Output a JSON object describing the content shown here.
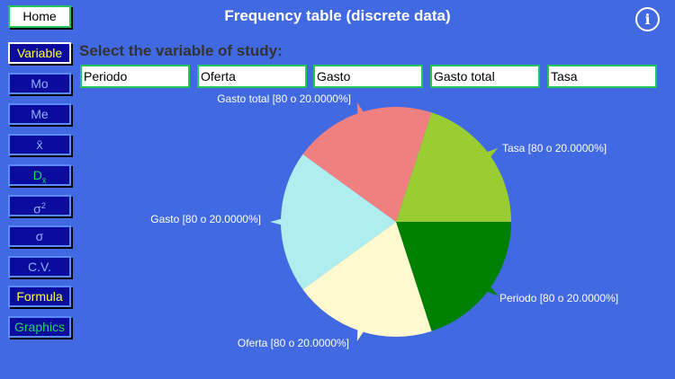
{
  "header": {
    "home_label": "Home",
    "title": "Frequency table (discrete data)",
    "info_label": "i"
  },
  "sidebar": {
    "items": [
      {
        "label": "Variable"
      },
      {
        "label": "Mo"
      },
      {
        "label": "Me"
      },
      {
        "label": "x̄"
      },
      {
        "label": "Dx̄"
      },
      {
        "label": "σ2"
      },
      {
        "label": "σ"
      },
      {
        "label": "C.V."
      },
      {
        "label": "Formula"
      },
      {
        "label": "Graphics"
      }
    ]
  },
  "main": {
    "prompt": "Select the variable of study:",
    "variables": [
      "Periodo",
      "Oferta",
      "Gasto",
      "Gasto total",
      "Tasa"
    ]
  },
  "chart_data": {
    "type": "pie",
    "slices": [
      {
        "name": "Periodo",
        "value": 80,
        "percent": "20.0000%",
        "color": "#008000",
        "label": "Periodo [80 o 20.0000%]"
      },
      {
        "name": "Oferta",
        "value": 80,
        "percent": "20.0000%",
        "color": "#fffacd",
        "label": "Oferta [80 o 20.0000%]"
      },
      {
        "name": "Gasto",
        "value": 80,
        "percent": "20.0000%",
        "color": "#afeeee",
        "label": "Gasto [80 o 20.0000%]"
      },
      {
        "name": "Gasto total",
        "value": 80,
        "percent": "20.0000%",
        "color": "#f08080",
        "label": "Gasto total [80 o 20.0000%]"
      },
      {
        "name": "Tasa",
        "value": 80,
        "percent": "20.0000%",
        "color": "#9acd32",
        "label": "Tasa  [80 o 20.0000%]"
      }
    ]
  }
}
